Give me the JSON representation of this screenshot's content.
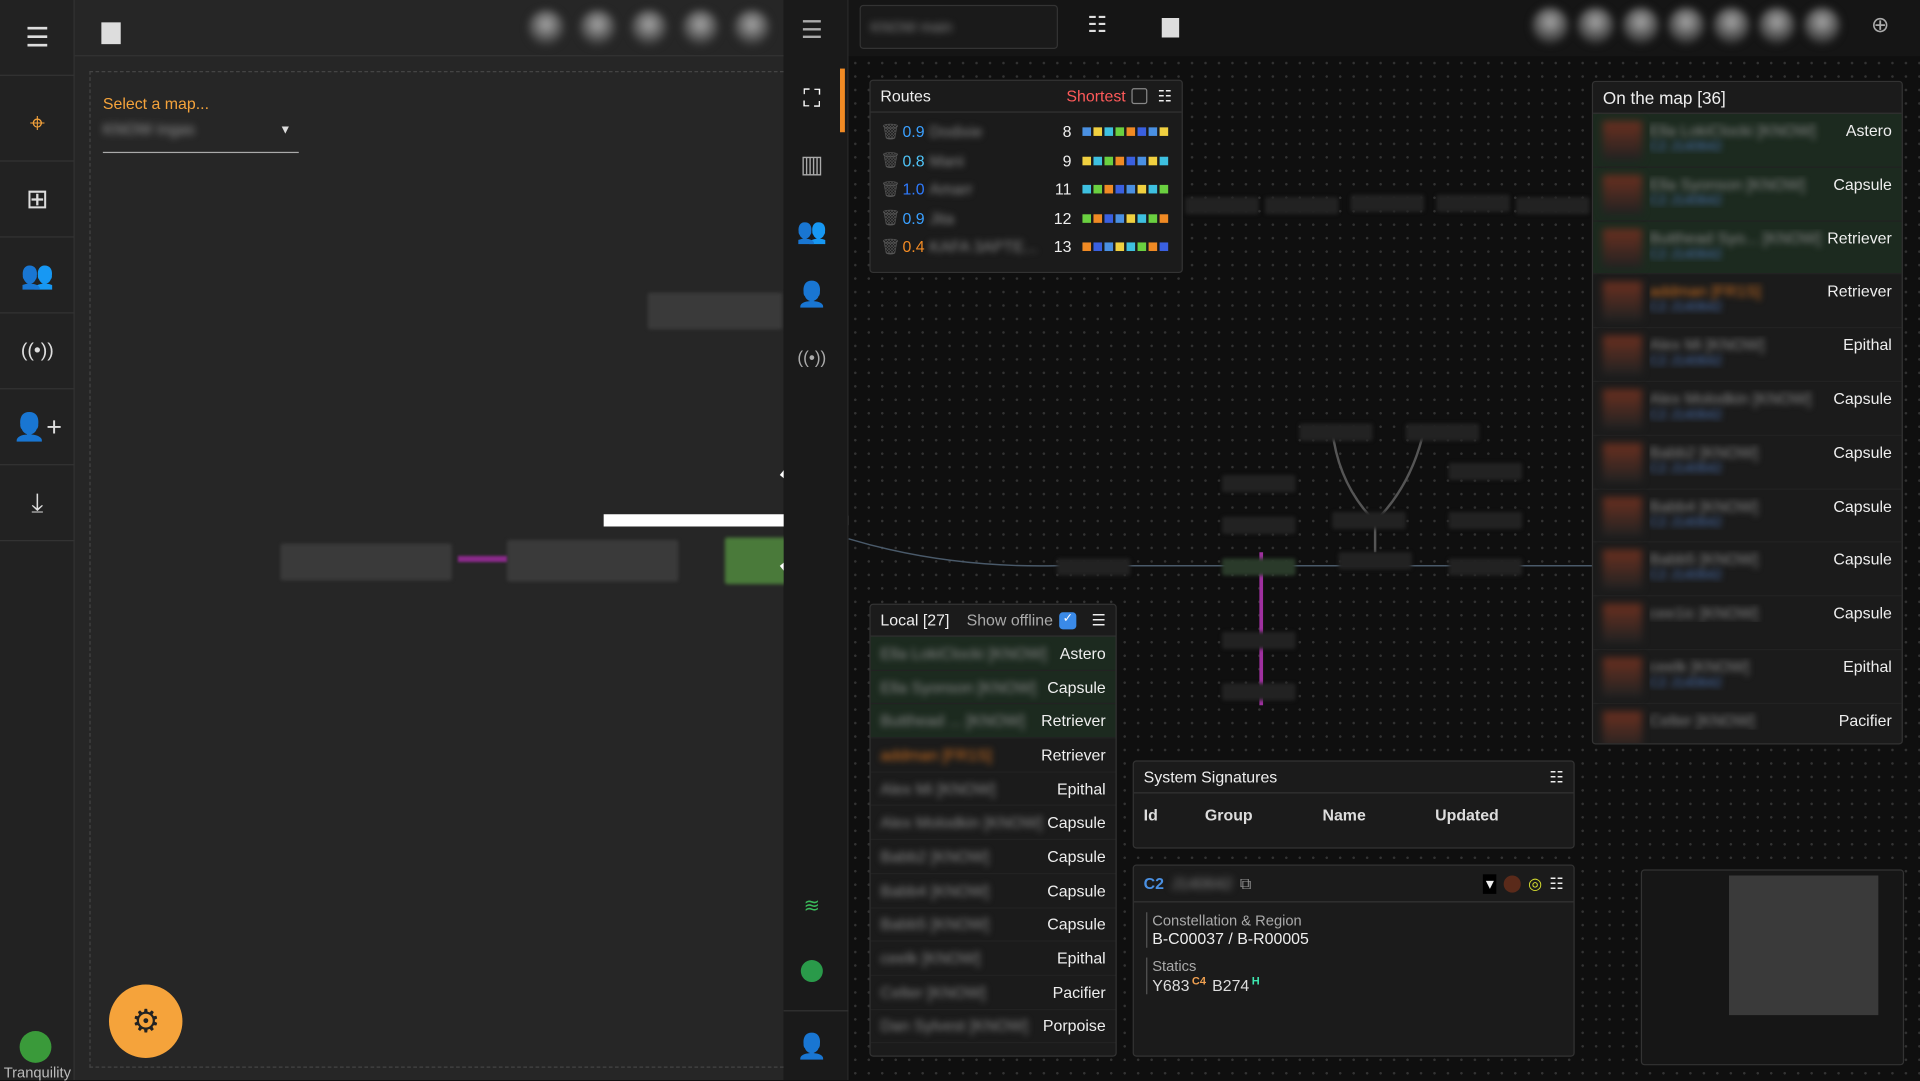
{
  "left": {
    "select_label": "Select a map...",
    "select_value": "KNOW ingas",
    "location": "Tranquility"
  },
  "right_top": {
    "map_name": "KNOW main"
  },
  "routes": {
    "title": "Routes",
    "mode": "Shortest",
    "rows": [
      {
        "sec": "0.9",
        "name": "Dodixie",
        "jumps": "8",
        "sec_color": "#3aa0ff"
      },
      {
        "sec": "0.8",
        "name": "Mani",
        "jumps": "9",
        "sec_color": "#4fc3f7"
      },
      {
        "sec": "1.0",
        "name": "Amarr",
        "jumps": "11",
        "sec_color": "#2f7bff"
      },
      {
        "sec": "0.9",
        "name": "Jita",
        "jumps": "12",
        "sec_color": "#3aa0ff"
      },
      {
        "sec": "0.4",
        "name": "KAFA 3APTE...",
        "jumps": "13",
        "sec_color": "#f08a24"
      }
    ]
  },
  "local": {
    "title": "Local [27]",
    "show_offline": "Show offline",
    "rows": [
      {
        "name": "Ella LokiClocki [KNOW]",
        "ship": "Astero",
        "hl": true
      },
      {
        "name": "Ella Syonson [KNOW]",
        "ship": "Capsule",
        "hl": true
      },
      {
        "name": "Butthead ... [KNOW]",
        "ship": "Retriever",
        "hl": true
      },
      {
        "name": "addman [FR1S]",
        "ship": "Retriever"
      },
      {
        "name": "Alex Mi [KNOW]",
        "ship": "Epithal"
      },
      {
        "name": "Alex Molodkin [KNOW]",
        "ship": "Capsule"
      },
      {
        "name": "Babb2 [KNOW]",
        "ship": "Capsule"
      },
      {
        "name": "Babb4 [KNOW]",
        "ship": "Capsule"
      },
      {
        "name": "Babb5 [KNOW]",
        "ship": "Capsule"
      },
      {
        "name": "ceelk [KNOW]",
        "ship": "Epithal"
      },
      {
        "name": "Celter [KNOW]",
        "ship": "Pacifier"
      },
      {
        "name": "Dan Sylvest [KNOW]",
        "ship": "Porpoise"
      }
    ]
  },
  "onmap": {
    "title": "On the map [36]",
    "rows": [
      {
        "name": "Ella LokiClocki [KNOW]",
        "sys": "C2 J140642",
        "ship": "Astero",
        "hl": true
      },
      {
        "name": "Ella Syonson [KNOW]",
        "sys": "C2 J140642",
        "ship": "Capsule",
        "hl": true
      },
      {
        "name": "Butthead Syo... [KNOW]",
        "sys": "C2 J140642",
        "ship": "Retriever",
        "hl": true
      },
      {
        "name": "addman [FR1S]",
        "sys": "C2 J140642",
        "ship": "Retriever"
      },
      {
        "name": "Alex Mi [KNOW]",
        "sys": "C2 J140642",
        "ship": "Epithal"
      },
      {
        "name": "Alex Molodkin [KNOW]",
        "sys": "C2 J140642",
        "ship": "Capsule"
      },
      {
        "name": "Babb2 [KNOW]",
        "sys": "C2 J140642",
        "ship": "Capsule"
      },
      {
        "name": "Babb4 [KNOW]",
        "sys": "C2 J140642",
        "ship": "Capsule"
      },
      {
        "name": "Babb5 [KNOW]",
        "sys": "C2 J140642",
        "ship": "Capsule"
      },
      {
        "name": "cee1ic [KNOW]",
        "sys": "",
        "ship": "Capsule"
      },
      {
        "name": "ceelk [KNOW]",
        "sys": "C2 J140642",
        "ship": "Epithal"
      },
      {
        "name": "Celter [KNOW]",
        "sys": "",
        "ship": "Pacifier"
      }
    ]
  },
  "signatures": {
    "title": "System Signatures",
    "columns": [
      "Id",
      "Group",
      "Name",
      "Updated"
    ]
  },
  "system": {
    "class": "C2",
    "name": "J140642",
    "cr_label": "Constellation & Region",
    "cr_value": "B-C00037 / B-R00005",
    "statics_label": "Statics",
    "statics": [
      {
        "id": "Y683",
        "dest": "C4",
        "color": "#f0a050"
      },
      {
        "id": "B274",
        "dest": "H",
        "color": "#3ee8b0"
      }
    ]
  },
  "colors": {
    "accent": "#f5a33b",
    "active": "#f08a24"
  }
}
